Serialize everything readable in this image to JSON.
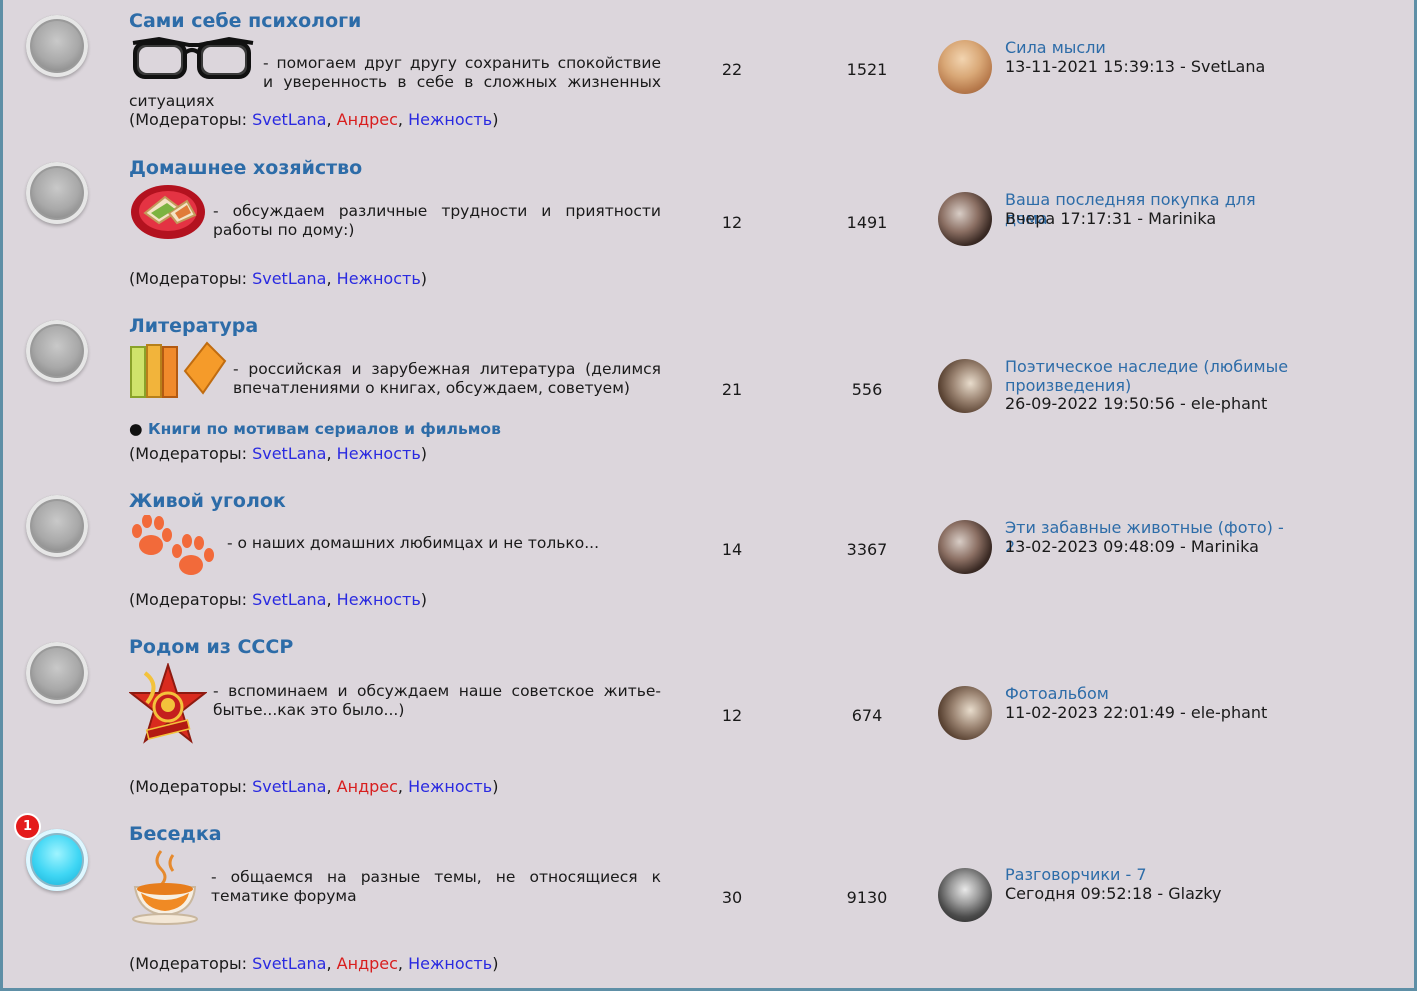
{
  "forums": [
    {
      "title": "Сами себе психологи",
      "icon": "glasses-icon",
      "description": "- помогаем друг другу сохранить спокойствие и уверенность в себе в сложных жизненных ситуациях",
      "moderators_label": "(Модераторы: ",
      "moderators": [
        "SvetLana",
        "Андрес",
        "Нежность"
      ],
      "topics": "22",
      "posts": "1521",
      "last_topic": "Сила мысли",
      "last_meta": "13-11-2021 15:39:13 - SvetLana"
    },
    {
      "title": "Домашнее хозяйство",
      "icon": "plate-with-food-icon",
      "description": "- обсуждаем различные трудности и приятности работы по дому:)",
      "moderators_label": "(Модераторы: ",
      "moderators": [
        "SvetLana",
        "Нежность"
      ],
      "topics": "12",
      "posts": "1491",
      "last_topic": "Ваша последняя покупка для дома",
      "last_meta": "Вчера 17:17:31 - Marinika"
    },
    {
      "title": "Литература",
      "icon": "books-icon",
      "description": "- российская и зарубежная литература (делимся впечатлениями о книгах, обсуждаем, советуем)",
      "subforum_bullet": "●",
      "subforum": "Книги по мотивам сериалов и фильмов",
      "moderators_label": "(Модераторы: ",
      "moderators": [
        "SvetLana",
        "Нежность"
      ],
      "topics": "21",
      "posts": "556",
      "last_topic": "Поэтическое наследие (любимые произведения)",
      "last_meta": "26-09-2022 19:50:56 - ele-phant"
    },
    {
      "title": "Живой уголок",
      "icon": "paw-prints-icon",
      "description": "- о наших домашних любимцах и не только...",
      "moderators_label": "(Модераторы: ",
      "moderators": [
        "SvetLana",
        "Нежность"
      ],
      "topics": "14",
      "posts": "3367",
      "last_topic": "Эти забавные животные (фото) - 2",
      "last_meta": "13-02-2023 09:48:09 - Marinika"
    },
    {
      "title": "Родом из СССР",
      "icon": "pioneer-badge-icon",
      "description": "- вспоминаем и обсуждаем наше советское житье-бытье...как это было...)",
      "moderators_label": "(Модераторы: ",
      "moderators": [
        "SvetLana",
        "Андрес",
        "Нежность"
      ],
      "topics": "12",
      "posts": "674",
      "last_topic": "Фотоальбом",
      "last_meta": "11-02-2023 22:01:49 - ele-phant"
    },
    {
      "title": "Беседка",
      "icon": "tea-cup-icon",
      "badge": "1",
      "description": "- общаемся на разные темы, не относящиеся к тематике форума",
      "moderators_label": "(Модераторы: ",
      "moderators": [
        "SvetLana",
        "Андрес",
        "Нежность"
      ],
      "topics": "30",
      "posts": "9130",
      "last_topic": "Разговорчики - 7",
      "last_meta": "Сегодня 09:52:18 - Glazky"
    }
  ],
  "punctuation": {
    "comma": ", ",
    "close": ")"
  },
  "colors": {
    "link": "#2d6ca8",
    "mod_blue": "#2a2ae0",
    "mod_red": "#d81e1e",
    "unread": "#3fd6f4",
    "background": "#dcd6dc"
  }
}
